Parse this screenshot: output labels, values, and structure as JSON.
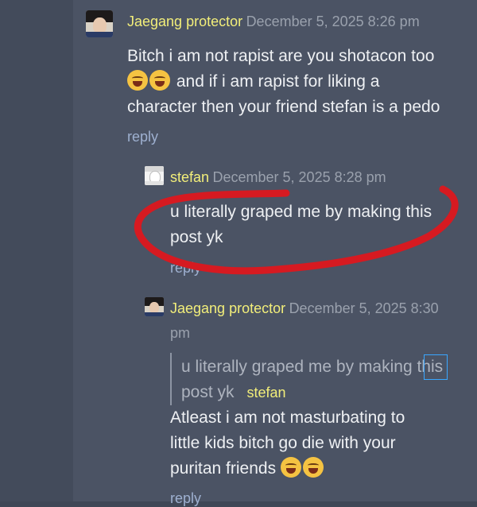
{
  "comments": [
    {
      "author": "Jaegang protector",
      "date": "December 5, 2025 8:26 pm",
      "line1": "Bitch i am not rapist are you shotacon too",
      "line2": "and if i am rapist for liking a",
      "line3": "character then your friend stefan is a pedo",
      "reply": "reply"
    },
    {
      "author": "stefan",
      "date": "December 5, 2025 8:28 pm",
      "line1": "u literally graped me by making this",
      "line2": "post yk",
      "reply": "reply"
    },
    {
      "author": "Jaegang protector",
      "date_line1": "December 5, 2025 8:30",
      "date_line2": "pm",
      "quote_line1": "u literally graped me by making this",
      "quote_line2": "post yk",
      "quote_author": "stefan",
      "line1": "Atleast i am not masturbating to",
      "line2": "little kids bitch go die with your",
      "line3": "puritan friends",
      "reply": "reply"
    }
  ],
  "annotation_color": "#d61a21"
}
